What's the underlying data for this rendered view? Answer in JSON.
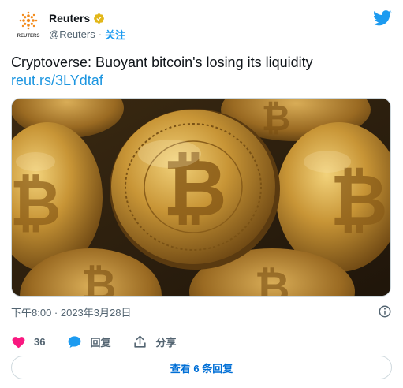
{
  "colors": {
    "brand_blue": "#1d9bf0",
    "link_blue": "#1b95e0",
    "like_pink": "#f91880",
    "verified_gold": "#e2b719",
    "reuters_orange": "#f38a1a",
    "muted_gray": "#536471"
  },
  "author": {
    "logo_text": "REUTERS",
    "display_name": "Reuters",
    "handle": "@Reuters",
    "separator": "·",
    "follow_label": "关注",
    "verified_icon": "verified-badge-icon"
  },
  "tweet": {
    "text": "Cryptoverse: Buoyant bitcoin's losing its liquidity",
    "link": "reut.rs/3LYdtaf",
    "media_description_icon": "photo-bitcoins",
    "timestamp": "下午8:00 · 2023年3月28日"
  },
  "actions": {
    "like_count": "36",
    "reply_label": "回复",
    "share_label": "分享"
  },
  "more_replies_label": "查看 6 条回复"
}
